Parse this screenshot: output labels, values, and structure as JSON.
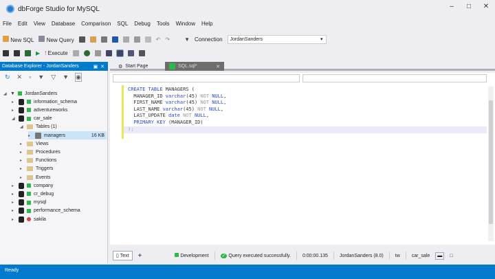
{
  "window": {
    "title": "dbForge Studio for MySQL",
    "controls": [
      "minimize",
      "maximize",
      "close"
    ]
  },
  "menu": [
    "File",
    "Edit",
    "View",
    "Database",
    "Comparison",
    "SQL",
    "Debug",
    "Tools",
    "Window",
    "Help"
  ],
  "toolbar": {
    "new_sql": "New SQL",
    "new_query": "New Query",
    "connection_label": "Connection",
    "connection_value": "JordanSanders",
    "execute": "Execute"
  },
  "explorer": {
    "title": "Database Explorer - JordanSanders",
    "tree": [
      {
        "label": "JordanSanders",
        "level": 0,
        "type": "connection"
      },
      {
        "label": "information_schema",
        "level": 1,
        "type": "db",
        "status": "green"
      },
      {
        "label": "adventureworks",
        "level": 1,
        "type": "db",
        "status": "green"
      },
      {
        "label": "car_sale",
        "level": 1,
        "type": "db",
        "status": "green",
        "expanded": true
      },
      {
        "label": "Tables (1)",
        "level": 2,
        "type": "folder",
        "expanded": true
      },
      {
        "label": "managers",
        "level": 3,
        "type": "table",
        "size": "16 KB",
        "selected": true
      },
      {
        "label": "Views",
        "level": 2,
        "type": "folder"
      },
      {
        "label": "Procedures",
        "level": 2,
        "type": "folder"
      },
      {
        "label": "Functions",
        "level": 2,
        "type": "folder"
      },
      {
        "label": "Triggers",
        "level": 2,
        "type": "folder"
      },
      {
        "label": "Events",
        "level": 2,
        "type": "folder"
      },
      {
        "label": "company",
        "level": 1,
        "type": "db",
        "status": "green"
      },
      {
        "label": "cr_debug",
        "level": 1,
        "type": "db",
        "status": "green"
      },
      {
        "label": "mysql",
        "level": 1,
        "type": "db",
        "status": "green"
      },
      {
        "label": "performance_schema",
        "level": 1,
        "type": "db",
        "status": "green"
      },
      {
        "label": "sakila",
        "level": 1,
        "type": "db",
        "status": "red"
      }
    ]
  },
  "tabs": [
    {
      "label": "Start Page",
      "active": false
    },
    {
      "label": "SQL.sql*",
      "active": true
    }
  ],
  "code": [
    [
      [
        "kw",
        "CREATE TABLE "
      ],
      [
        "nm",
        "MANAGERS ("
      ]
    ],
    [
      [
        "nm",
        "  MANAGER_ID "
      ],
      [
        "kw",
        "varchar"
      ],
      [
        "nm",
        "(45) "
      ],
      [
        "gr",
        "NOT "
      ],
      [
        "kw",
        "NULL"
      ],
      [
        "nm",
        ","
      ]
    ],
    [
      [
        "nm",
        "  FIRST_NAME "
      ],
      [
        "kw",
        "varchar"
      ],
      [
        "nm",
        "(45) "
      ],
      [
        "gr",
        "NOT "
      ],
      [
        "kw",
        "NULL"
      ],
      [
        "nm",
        ","
      ]
    ],
    [
      [
        "nm",
        "  LAST_NAME "
      ],
      [
        "kw",
        "varchar"
      ],
      [
        "nm",
        "(45) "
      ],
      [
        "gr",
        "NOT "
      ],
      [
        "kw",
        "NULL"
      ],
      [
        "nm",
        ","
      ]
    ],
    [
      [
        "nm",
        "  LAST_UPDATE "
      ],
      [
        "kw",
        "date "
      ],
      [
        "gr",
        "NOT "
      ],
      [
        "kw",
        "NULL"
      ],
      [
        "nm",
        ","
      ]
    ],
    [
      [
        "kw",
        "  PRIMARY KEY "
      ],
      [
        "nm",
        "(MANAGER_ID)"
      ]
    ],
    [
      [
        "gr",
        ");"
      ]
    ]
  ],
  "statusbar": {
    "text_tab": "Text",
    "add": "+",
    "environment": "Development",
    "message": "Query executed successfully.",
    "duration": "0:00:00.135",
    "user": "JordanSanders (8.0)",
    "tw": "tw",
    "database": "car_sale"
  },
  "appstatus": "Ready",
  "colors": {
    "accent": "#007acc",
    "ok": "#2db84c",
    "error": "#e04040"
  }
}
